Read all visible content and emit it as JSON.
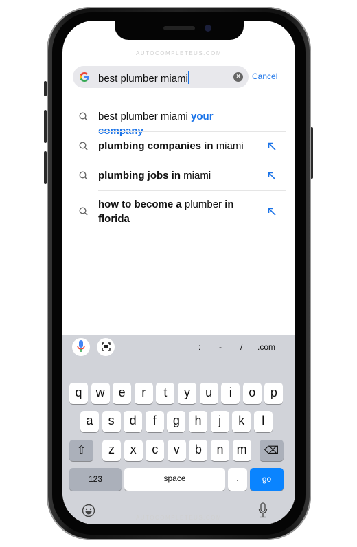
{
  "watermark": "AUTOCOMPLETEUS.COM",
  "search": {
    "query": "best plumber miami",
    "cancel": "Cancel"
  },
  "suggestions": [
    {
      "parts": [
        {
          "t": "best plumber miami ",
          "s": "n"
        },
        {
          "t": "your company",
          "s": "blue"
        }
      ],
      "arrow": false
    },
    {
      "parts": [
        {
          "t": "plumbing companies in ",
          "s": "b"
        },
        {
          "t": "miami",
          "s": "n"
        }
      ],
      "arrow": true
    },
    {
      "parts": [
        {
          "t": "plumbing jobs in ",
          "s": "b"
        },
        {
          "t": "miami",
          "s": "n"
        }
      ],
      "arrow": true
    },
    {
      "parts": [
        {
          "t": "how to become a ",
          "s": "b"
        },
        {
          "t": "plumber ",
          "s": "n"
        },
        {
          "t": "in florida",
          "s": "b"
        }
      ],
      "arrow": true
    }
  ],
  "keyboard": {
    "shortcuts": [
      ":",
      "-",
      "/",
      ".com"
    ],
    "rows": [
      [
        "q",
        "w",
        "e",
        "r",
        "t",
        "y",
        "u",
        "i",
        "o",
        "p"
      ],
      [
        "a",
        "s",
        "d",
        "f",
        "g",
        "h",
        "j",
        "k",
        "l"
      ],
      [
        "z",
        "x",
        "c",
        "v",
        "b",
        "n",
        "m"
      ]
    ],
    "numbers": "123",
    "space": "space",
    "period": ".",
    "go": "go"
  },
  "colors": {
    "accent": "#1a73e8",
    "go": "#0a84ff"
  }
}
